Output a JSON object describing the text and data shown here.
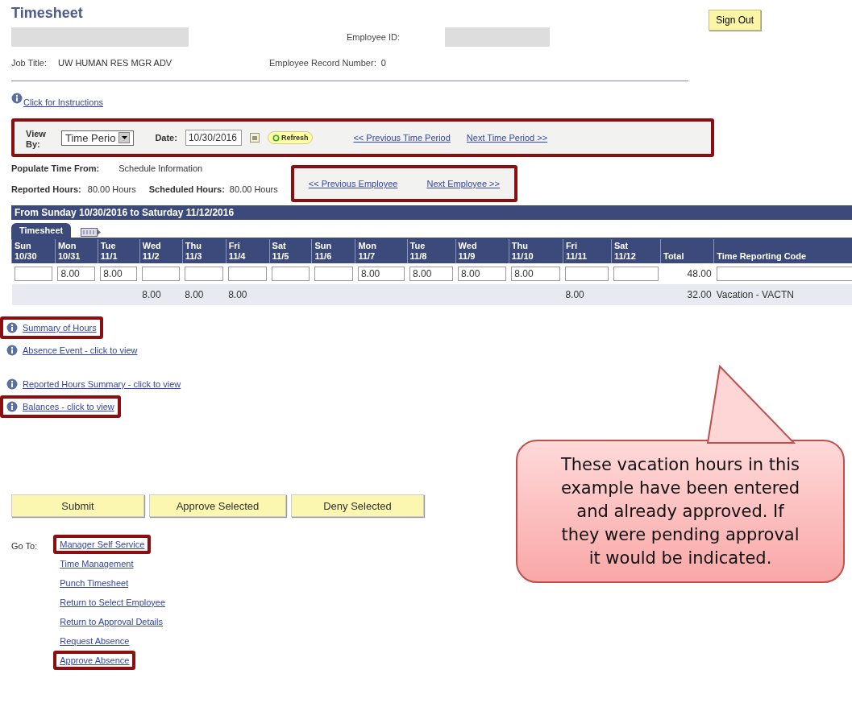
{
  "header": {
    "title": "Timesheet",
    "sign_out": "Sign Out",
    "employee_id_label": "Employee ID:",
    "job_title_label": "Job Title:",
    "job_title": "UW HUMAN RES MGR ADV",
    "record_label": "Employee Record Number:",
    "record_number": "0"
  },
  "instructions_link": "Click for Instructions",
  "view_bar": {
    "highlighted": true,
    "view_label": "View By:",
    "view_value": "Time Perio",
    "date_label": "Date:",
    "date_value": "10/30/2016",
    "refresh": "Refresh",
    "prev": "<< Previous Time Period",
    "next": "Next Time Period >>"
  },
  "populate": {
    "label": "Populate Time From:",
    "value": "Schedule Information"
  },
  "hours": {
    "reported_label": "Reported Hours:",
    "reported": "80.00 Hours",
    "scheduled_label": "Scheduled Hours:",
    "scheduled": "80.00 Hours"
  },
  "employee_nav": {
    "highlighted": true,
    "prev": "<< Previous Employee",
    "next": "Next Employee >>"
  },
  "period_band": "From Sunday 10/30/2016 to Saturday 11/12/2016",
  "tabs": [
    {
      "label": "Timesheet",
      "selected": true
    }
  ],
  "table": {
    "columns": [
      {
        "day": "Sun",
        "date": "10/30"
      },
      {
        "day": "Mon",
        "date": "10/31"
      },
      {
        "day": "Tue",
        "date": "11/1"
      },
      {
        "day": "Wed",
        "date": "11/2"
      },
      {
        "day": "Thu",
        "date": "11/3"
      },
      {
        "day": "Fri",
        "date": "11/4"
      },
      {
        "day": "Sat",
        "date": "11/5"
      },
      {
        "day": "Sun",
        "date": "11/6"
      },
      {
        "day": "Mon",
        "date": "11/7"
      },
      {
        "day": "Tue",
        "date": "11/8"
      },
      {
        "day": "Wed",
        "date": "11/9"
      },
      {
        "day": "Thu",
        "date": "11/10"
      },
      {
        "day": "Fri",
        "date": "11/11"
      },
      {
        "day": "Sat",
        "date": "11/12"
      }
    ],
    "total_header": "Total",
    "code_header": "Time Reporting Code",
    "rows": [
      {
        "kind": "entry",
        "cells": [
          null,
          "8.00",
          "8.00",
          null,
          null,
          null,
          null,
          null,
          "8.00",
          "8.00",
          "8.00",
          "8.00",
          null,
          null
        ],
        "total": "48.00"
      },
      {
        "kind": "reported",
        "cells": [
          null,
          null,
          null,
          "8.00",
          "8.00",
          "8.00",
          null,
          null,
          null,
          null,
          null,
          null,
          "8.00",
          null
        ],
        "total": "32.00",
        "code": "Vacation - VACTN"
      }
    ]
  },
  "info_links": [
    {
      "label": "Summary of Hours",
      "highlighted": true
    },
    {
      "label": "Absence Event - click to view",
      "highlighted": false
    },
    {
      "label": "Reported Hours Summary - click to view",
      "highlighted": false
    },
    {
      "label": "Balances - click to view",
      "highlighted": true
    }
  ],
  "buttons": [
    "Submit",
    "Approve Selected",
    "Deny Selected"
  ],
  "goto": {
    "label": "Go To:",
    "links": [
      {
        "label": "Manager Self Service",
        "highlighted": true
      },
      {
        "label": "Time Management",
        "highlighted": false
      },
      {
        "label": "Punch Timesheet",
        "highlighted": false
      },
      {
        "label": "Return to Select Employee",
        "highlighted": false
      },
      {
        "label": "Return to Approval Details",
        "highlighted": false
      },
      {
        "label": "Request Absence",
        "highlighted": false
      },
      {
        "label": "Approve Absence",
        "highlighted": true
      }
    ]
  },
  "callout": "These vacation hours in this example have been entered and already approved. If they were pending approval it would be indicated."
}
